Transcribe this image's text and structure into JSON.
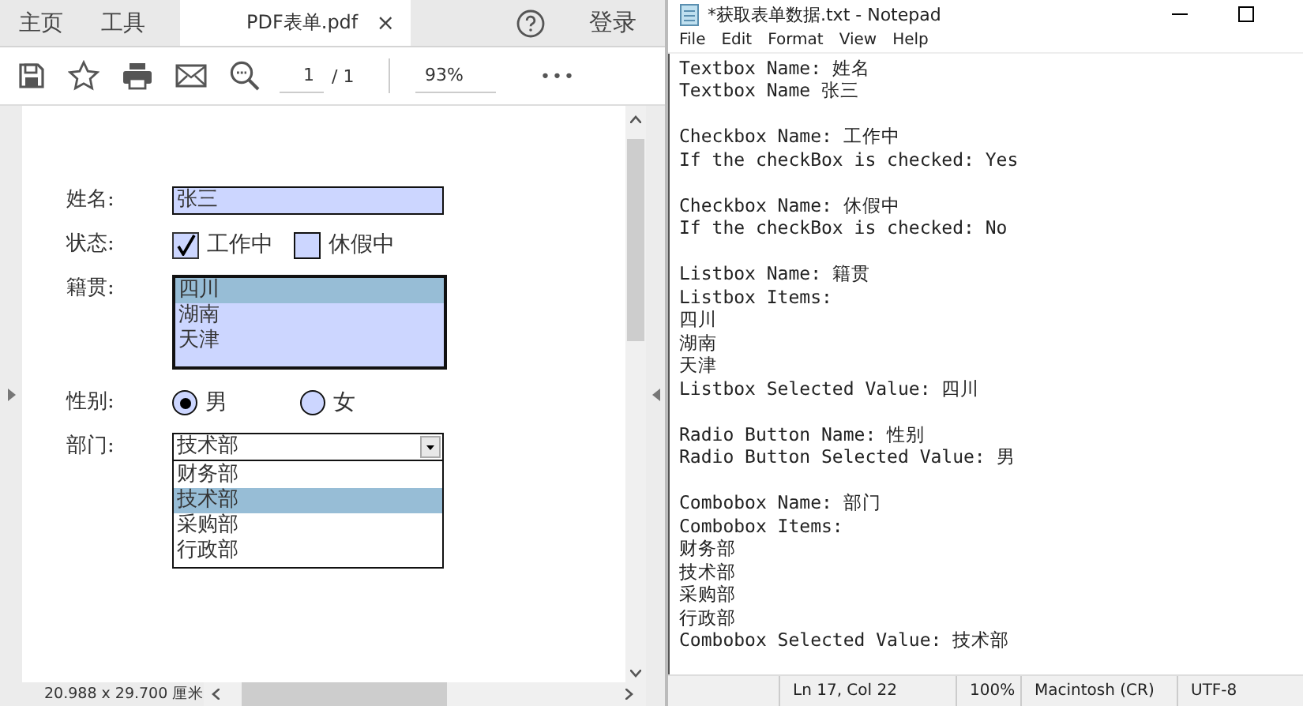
{
  "pdf_viewer": {
    "tabs": [
      {
        "label": "主页",
        "selected": false
      },
      {
        "label": "工具",
        "selected": false
      },
      {
        "label": "PDF表单.pdf",
        "selected": true,
        "close": "×"
      }
    ],
    "login": "登录",
    "toolbar": {
      "page": "1",
      "page_total": "/ 1",
      "zoom": "93%",
      "more": "•••"
    },
    "form": [
      {
        "kind": "text",
        "label": "姓名:",
        "value": "张三"
      },
      {
        "kind": "checkboxes",
        "label": "状态:",
        "options": [
          {
            "label": "工作中",
            "checked": true
          },
          {
            "label": "休假中",
            "checked": false
          }
        ]
      },
      {
        "kind": "listbox",
        "label": "籍贯:",
        "options": [
          {
            "label": "四川",
            "selected": true
          },
          {
            "label": "湖南",
            "selected": false
          },
          {
            "label": "天津",
            "selected": false
          }
        ]
      },
      {
        "kind": "radio",
        "label": "性别:",
        "options": [
          {
            "label": "男",
            "selected": true
          },
          {
            "label": "女",
            "selected": false
          }
        ]
      },
      {
        "kind": "combobox",
        "label": "部门:",
        "value": "技术部",
        "expanded": true,
        "options": [
          {
            "label": "财务部",
            "selected": false
          },
          {
            "label": "技术部",
            "selected": true
          },
          {
            "label": "采购部",
            "selected": false
          },
          {
            "label": "行政部",
            "selected": false
          }
        ]
      }
    ],
    "page_size": "20.988 x 29.700 厘米"
  },
  "notepad": {
    "title": "*获取表单数据.txt - Notepad",
    "menu": [
      "File",
      "Edit",
      "Format",
      "View",
      "Help"
    ],
    "paragraphs": [
      [
        "Textbox Name: 姓名",
        "Textbox Name 张三"
      ],
      [
        "Checkbox Name: 工作中",
        "If the checkBox is checked: Yes"
      ],
      [
        "Checkbox Name: 休假中",
        "If the checkBox is checked: No"
      ],
      [
        "Listbox Name: 籍贯",
        "Listbox Items:",
        "四川",
        "湖南",
        "天津",
        "Listbox Selected Value: 四川"
      ],
      [
        "Radio Button Name: 性别",
        "Radio Button Selected Value: 男"
      ],
      [
        "Combobox Name: 部门",
        "Combobox Items:",
        "财务部",
        "技术部",
        "采购部",
        "行政部",
        "Combobox Selected Value: 技术部"
      ]
    ],
    "status_bar": [
      "Ln 17, Col 22",
      "100%",
      "Macintosh (CR)",
      "UTF-8"
    ]
  }
}
